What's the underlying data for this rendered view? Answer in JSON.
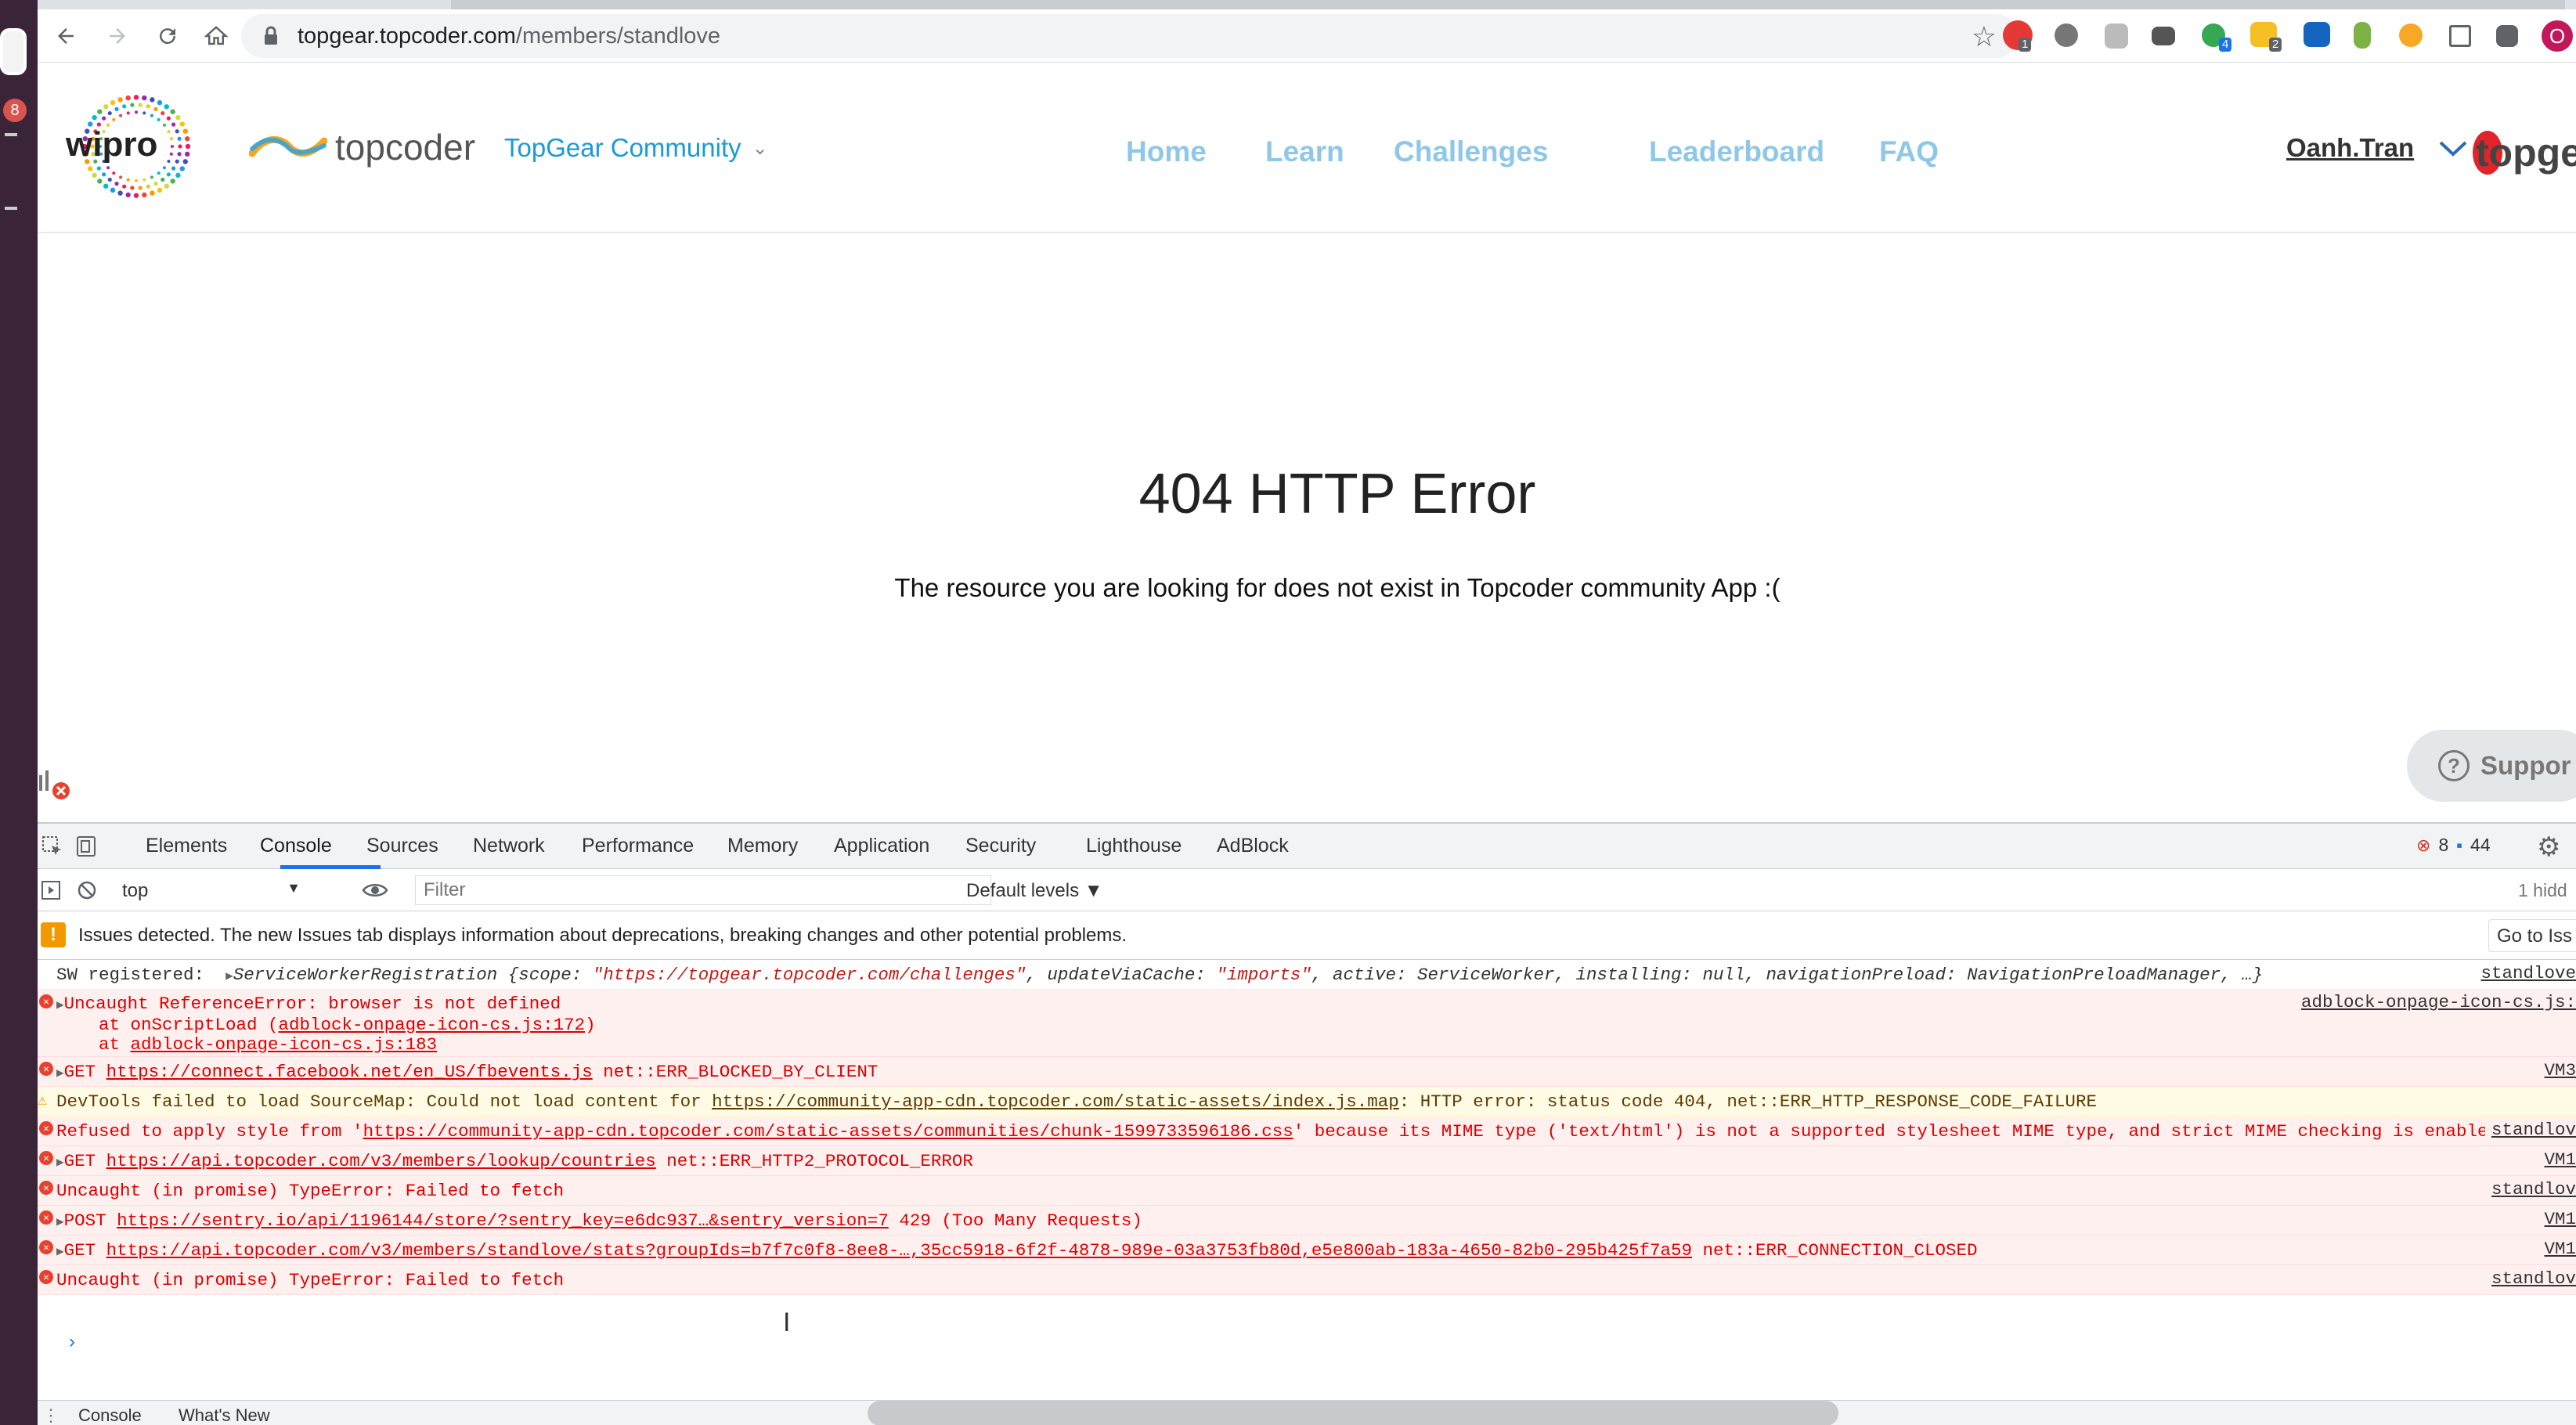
{
  "dock": {
    "badge": "8"
  },
  "browser": {
    "url_host": "topgear.topcoder.com",
    "url_path": "/members/standlove",
    "extension_badges": [
      "1",
      "4",
      "2"
    ],
    "profile_initial": "O"
  },
  "site": {
    "wipro_logo": "wipro",
    "topcoder_logo": "topcoder",
    "community_label": "TopGear Community",
    "nav": [
      "Home",
      "Learn",
      "Challenges",
      "Leaderboard",
      "FAQ"
    ],
    "user": "Oanh.Tran",
    "topgear_logo": "topge"
  },
  "content": {
    "error_title": "404 HTTP Error",
    "error_message": "The resource you are looking for does not exist in Topcoder community App :("
  },
  "support": {
    "label": "Suppor"
  },
  "devtools": {
    "tabs": [
      "Elements",
      "Console",
      "Sources",
      "Network",
      "Performance",
      "Memory",
      "Application",
      "Security",
      "Lighthouse",
      "AdBlock"
    ],
    "active_tab": "Console",
    "error_count": "8",
    "message_count": "44",
    "context": "top",
    "filter_placeholder": "Filter",
    "levels": "Default levels ▼",
    "hidden": "1 hidd",
    "issues_text": "Issues detected. The new Issues tab displays information about deprecations, breaking changes and other potential problems.",
    "issues_button": "Go to Iss",
    "drawer_tabs": [
      "Console",
      "What's New"
    ]
  },
  "console": {
    "sw_prefix": "SW registered: ",
    "sw_obj": "ServiceWorkerRegistration {scope: ",
    "sw_scope": "\"https://topgear.topcoder.com/challenges\"",
    "sw_mid": ", updateViaCache: ",
    "sw_cache": "\"imports\"",
    "sw_rest": ", active: ServiceWorker, installing: null, navigationPreload: NavigationPreloadManager, …}",
    "sw_src": "standlove",
    "ref_line1": "Uncaught ReferenceError: browser is not defined",
    "ref_line2a": "    at onScriptLoad (",
    "ref_line2b": "adblock-onpage-icon-cs.js:172",
    "ref_line2c": ")",
    "ref_line3a": "    at ",
    "ref_line3b": "adblock-onpage-icon-cs.js:183",
    "ref_src": "adblock-onpage-icon-cs.js:",
    "fb_get": "GET ",
    "fb_url": "https://connect.facebook.net/en_US/fbevents.js",
    "fb_err": " net::ERR_BLOCKED_BY_CLIENT",
    "fb_src": "VM3",
    "dt_text": "DevTools failed to load SourceMap: Could not load content for ",
    "dt_url": "https://community-app-cdn.topcoder.com/static-assets/index.js.map",
    "dt_err": ": HTTP error: status code 404, net::ERR_HTTP_RESPONSE_CODE_FAILURE",
    "refused_a": "Refused to apply style from '",
    "refused_url": "https://community-app-cdn.topcoder.com/static-assets/communities/chunk-1599733596186.css",
    "refused_b": "' because its MIME type ('text/html') is not a supported stylesheet MIME type, and strict MIME checking is enabled.",
    "refused_src": "standlov",
    "api_get": "GET ",
    "api_url": "https://api.topcoder.com/v3/members/lookup/countries",
    "api_err": " net::ERR_HTTP2_PROTOCOL_ERROR",
    "api_src": "VM1",
    "fetch1": "Uncaught (in promise) TypeError: Failed to fetch",
    "fetch1_src": "standlov",
    "post_a": "POST ",
    "post_url": "https://sentry.io/api/1196144/store/?sentry_key=e6dc937…&sentry_version=7",
    "post_err": " 429 (Too Many Requests)",
    "post_src": "VM1",
    "stats_get": "GET ",
    "stats_url": "https://api.topcoder.com/v3/members/standlove/stats?groupIds=b7f7c0f8-8ee8-…,35cc5918-6f2f-4878-989e-03a3753fb80d,e5e800ab-183a-4650-82b0-295b425f7a59",
    "stats_err": " net::ERR_CONNECTION_CLOSED",
    "stats_src": "VM1",
    "fetch2": "Uncaught (in promise) TypeError: Failed to fetch",
    "fetch2_src": "standlov"
  }
}
